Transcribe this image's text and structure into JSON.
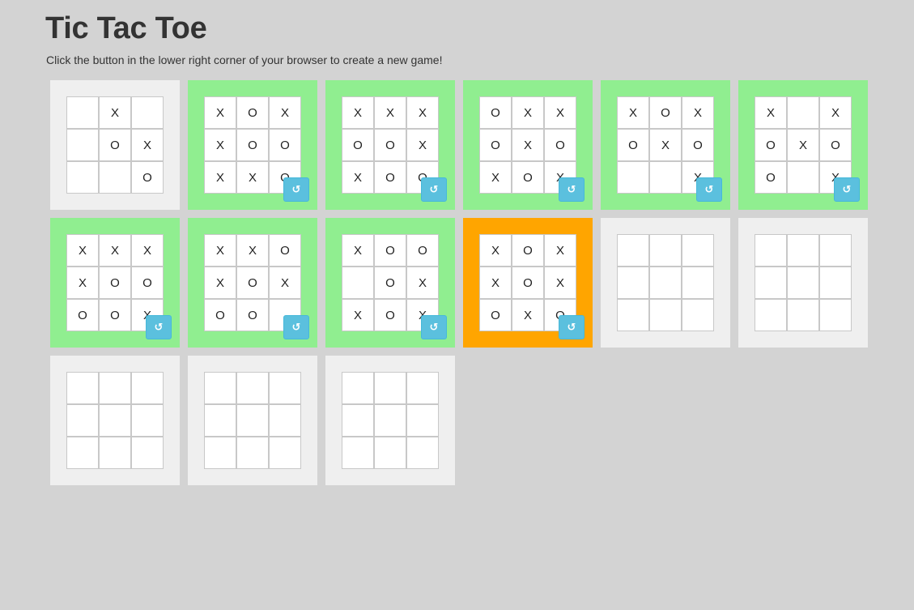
{
  "title": "Tic Tac Toe",
  "subtitle": "Click the button in the lower right corner of your browser to create a new game!",
  "reset_icon": "refresh-icon",
  "colors": {
    "won": "#90ee90",
    "draw": "#ffa500",
    "empty": "#efefef",
    "button": "#5bc0de"
  },
  "boards": [
    {
      "status": "in-progress",
      "cells": [
        "",
        "X",
        "",
        "",
        "O",
        "X",
        "",
        "",
        "O"
      ]
    },
    {
      "status": "won",
      "cells": [
        "X",
        "O",
        "X",
        "X",
        "O",
        "O",
        "X",
        "X",
        "O"
      ]
    },
    {
      "status": "won",
      "cells": [
        "X",
        "X",
        "X",
        "O",
        "O",
        "X",
        "X",
        "O",
        "O"
      ]
    },
    {
      "status": "won",
      "cells": [
        "O",
        "X",
        "X",
        "O",
        "X",
        "O",
        "X",
        "O",
        "X"
      ]
    },
    {
      "status": "won",
      "cells": [
        "X",
        "O",
        "X",
        "O",
        "X",
        "O",
        "",
        "",
        "X"
      ]
    },
    {
      "status": "won",
      "cells": [
        "X",
        "",
        "X",
        "O",
        "X",
        "O",
        "O",
        "",
        "X"
      ]
    },
    {
      "status": "won",
      "cells": [
        "X",
        "X",
        "X",
        "X",
        "O",
        "O",
        "O",
        "O",
        "X"
      ]
    },
    {
      "status": "won",
      "cells": [
        "X",
        "X",
        "O",
        "X",
        "O",
        "X",
        "O",
        "O",
        ""
      ]
    },
    {
      "status": "won",
      "cells": [
        "X",
        "O",
        "O",
        "",
        "O",
        "X",
        "X",
        "O",
        "X"
      ]
    },
    {
      "status": "draw",
      "cells": [
        "X",
        "O",
        "X",
        "X",
        "O",
        "X",
        "O",
        "X",
        "O"
      ]
    },
    {
      "status": "empty",
      "cells": [
        "",
        "",
        "",
        "",
        "",
        "",
        "",
        "",
        ""
      ]
    },
    {
      "status": "empty",
      "cells": [
        "",
        "",
        "",
        "",
        "",
        "",
        "",
        "",
        ""
      ]
    },
    {
      "status": "empty",
      "cells": [
        "",
        "",
        "",
        "",
        "",
        "",
        "",
        "",
        ""
      ]
    },
    {
      "status": "empty",
      "cells": [
        "",
        "",
        "",
        "",
        "",
        "",
        "",
        "",
        ""
      ]
    },
    {
      "status": "empty",
      "cells": [
        "",
        "",
        "",
        "",
        "",
        "",
        "",
        "",
        ""
      ]
    }
  ]
}
